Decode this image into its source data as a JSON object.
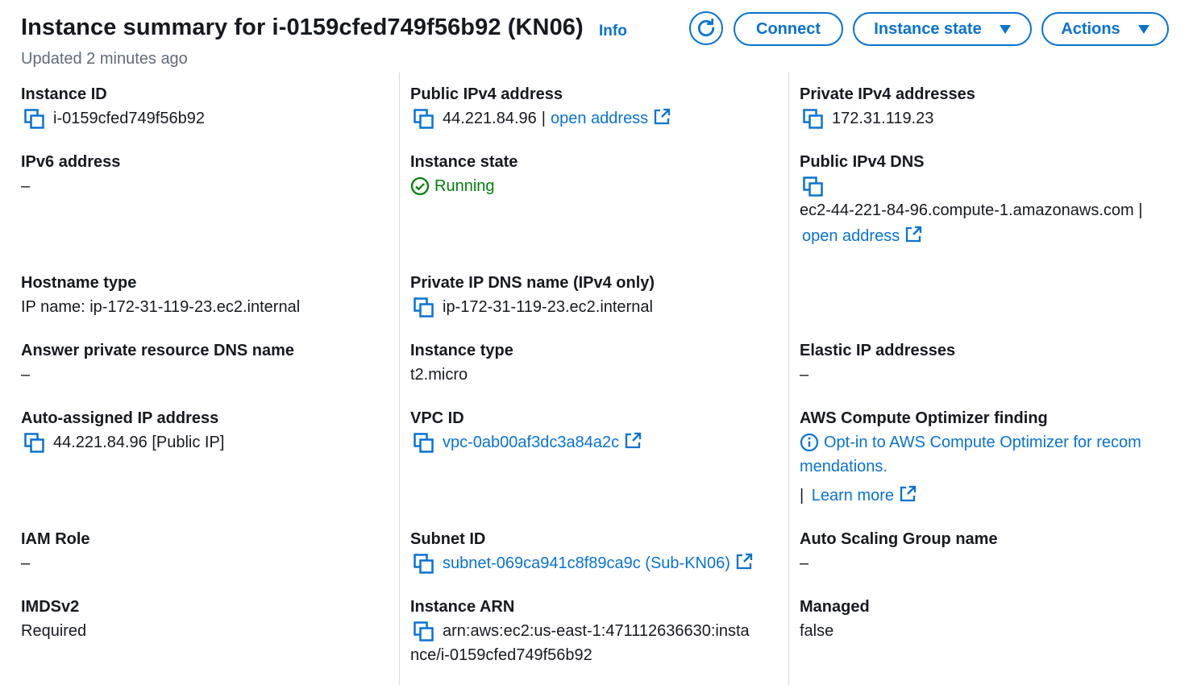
{
  "header": {
    "title": "Instance summary for i-0159cfed749f56b92 (KN06)",
    "info": "Info",
    "updated": "Updated 2 minutes ago",
    "buttons": {
      "connect": "Connect",
      "instance_state": "Instance state",
      "actions": "Actions"
    }
  },
  "fields": {
    "instance_id": {
      "label": "Instance ID",
      "value": "i-0159cfed749f56b92"
    },
    "public_ipv4": {
      "label": "Public IPv4 address",
      "value": "44.221.84.96",
      "sep": "|",
      "link": "open address"
    },
    "private_ipv4": {
      "label": "Private IPv4 addresses",
      "value": "172.31.119.23"
    },
    "ipv6": {
      "label": "IPv6 address",
      "value": "–"
    },
    "instance_state": {
      "label": "Instance state",
      "value": "Running"
    },
    "public_dns": {
      "label": "Public IPv4 DNS",
      "value": "ec2-44-221-84-96.compute-1.amazonaws.com",
      "sep": "|",
      "link": "open address"
    },
    "hostname_type": {
      "label": "Hostname type",
      "value": "IP name: ip-172-31-119-23.ec2.internal"
    },
    "private_dns": {
      "label": "Private IP DNS name (IPv4 only)",
      "value": "ip-172-31-119-23.ec2.internal"
    },
    "answer_dns": {
      "label": "Answer private resource DNS name",
      "value": "–"
    },
    "instance_type": {
      "label": "Instance type",
      "value": "t2.micro"
    },
    "elastic_ip": {
      "label": "Elastic IP addresses",
      "value": "–"
    },
    "auto_ip": {
      "label": "Auto-assigned IP address",
      "value": "44.221.84.96 [Public IP]"
    },
    "vpc_id": {
      "label": "VPC ID",
      "value": "vpc-0ab00af3dc3a84a2c"
    },
    "optimizer": {
      "label": "AWS Compute Optimizer finding",
      "line1": "Opt-in to AWS Compute Optimizer for recom",
      "line2": "mendations.",
      "sep": "|",
      "learn": "Learn more"
    },
    "iam_role": {
      "label": "IAM Role",
      "value": "–"
    },
    "subnet_id": {
      "label": "Subnet ID",
      "value": "subnet-069ca941c8f89ca9c (Sub-KN06)"
    },
    "asg_name": {
      "label": "Auto Scaling Group name",
      "value": "–"
    },
    "imdsv2": {
      "label": "IMDSv2",
      "value": "Required"
    },
    "instance_arn": {
      "label": "Instance ARN",
      "line1": "arn:aws:ec2:us-east-1:471112636630:insta",
      "line2": "nce/i-0159cfed749f56b92"
    },
    "managed": {
      "label": "Managed",
      "value": "false"
    }
  },
  "colors": {
    "link": "#0972d3",
    "success": "#037f0c",
    "muted": "#5f6b7a"
  },
  "icons": [
    "refresh-icon",
    "copy-icon",
    "external-link-icon",
    "check-circle-icon",
    "info-circle-icon",
    "caret-down-icon"
  ]
}
